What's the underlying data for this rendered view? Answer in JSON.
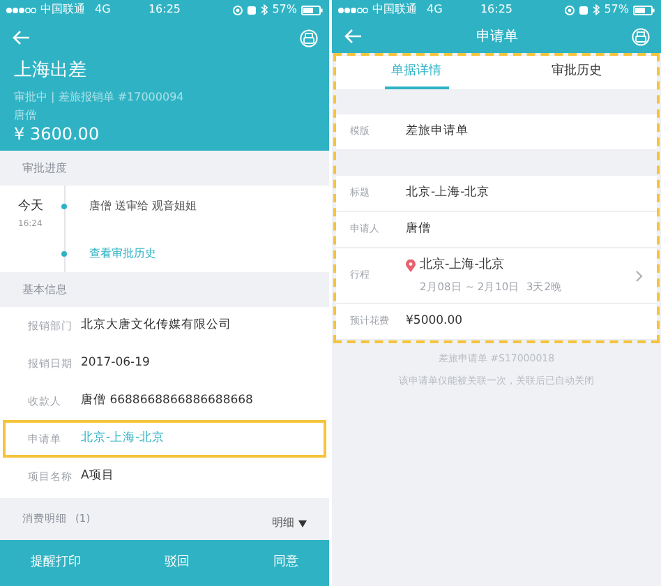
{
  "screens": [
    {
      "status_bar": {
        "carrier": "中国联通",
        "network": "4G",
        "time": "16:25",
        "battery": "57%"
      },
      "header": {
        "title": "上海出差",
        "subtitle": "审批中 | 差旅报销单 #17000094",
        "person": "唐僧",
        "amount": "¥ 3600.00"
      },
      "progress": {
        "heading": "审批进度",
        "day": "今天",
        "time": "16:24",
        "event": "唐僧 送审给 观音姐姐",
        "history_link": "查看审批历史"
      },
      "basic_info": {
        "heading": "基本信息",
        "rows": [
          {
            "label": "报销部门",
            "value": "北京大唐文化传媒有限公司",
            "kind": "text",
            "highlighted": false
          },
          {
            "label": "报销日期",
            "value": "2017-06-19",
            "kind": "text",
            "highlighted": false
          },
          {
            "label": "收款人",
            "value": "唐僧 6688668866886688668",
            "kind": "text",
            "highlighted": false
          },
          {
            "label": "申请单",
            "value": "北京-上海-北京",
            "kind": "link",
            "highlighted": true
          },
          {
            "label": "项目名称",
            "value": "A项目",
            "kind": "text",
            "highlighted": false
          }
        ]
      },
      "expense": {
        "label": "消费明细",
        "count": "(1)",
        "toggle": "明细"
      },
      "actions": [
        "提醒打印",
        "驳回",
        "同意"
      ]
    },
    {
      "status_bar": {
        "carrier": "中国联通",
        "network": "4G",
        "time": "16:25",
        "battery": "57%"
      },
      "nav_title": "申请单",
      "tabs": [
        {
          "label": "单据详情",
          "selected": true
        },
        {
          "label": "审批历史",
          "selected": false
        }
      ],
      "form": {
        "highlighted": true,
        "rows": [
          {
            "label": "模版",
            "value": "差旅申请单",
            "kind": "text",
            "gap_before": true
          },
          {
            "label": "标题",
            "value": "北京-上海-北京",
            "kind": "text",
            "gap_before": true
          },
          {
            "label": "申请人",
            "value": "唐僧",
            "kind": "text",
            "gap_before": false
          },
          {
            "label": "行程",
            "value": "北京-上海-北京",
            "detail": "2月08日 ~ 2月10日  3天2晚",
            "kind": "trip",
            "gap_before": false
          },
          {
            "label": "预计花费",
            "value": "¥5000.00",
            "kind": "text",
            "gap_before": false
          }
        ]
      },
      "footer_notes": [
        "差旅申请单 #S17000018",
        "该申请单仅能被关联一次，关联后已自动关闭"
      ]
    }
  ]
}
